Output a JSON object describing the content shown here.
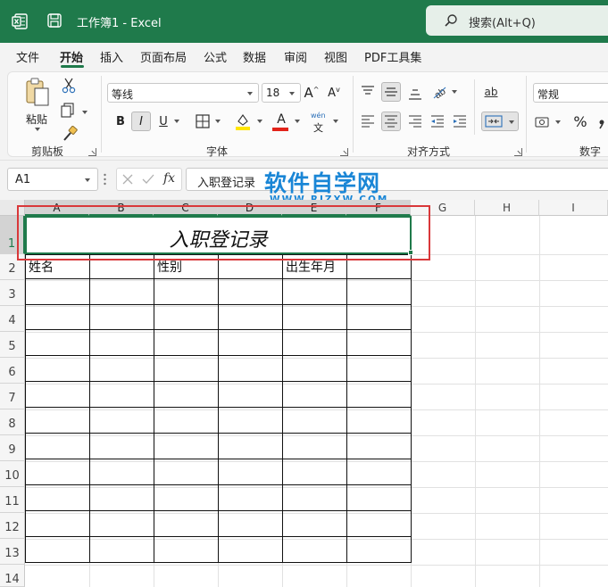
{
  "titlebar": {
    "doc_title": "工作簿1  -  Excel",
    "search_label": "搜索(Alt+Q)"
  },
  "tabs": [
    "文件",
    "开始",
    "插入",
    "页面布局",
    "公式",
    "数据",
    "审阅",
    "视图",
    "PDF工具集"
  ],
  "active_tab": "开始",
  "ribbon": {
    "clipboard": {
      "paste_label": "粘贴",
      "group_label": "剪贴板"
    },
    "font": {
      "font_name": "等线",
      "font_size": "18",
      "bold": "B",
      "italic": "I",
      "underline": "U",
      "grow": "A",
      "shrink": "A",
      "font_color": "A",
      "phonetic_top": "wén",
      "phonetic_bottom": "文",
      "group_label": "字体"
    },
    "alignment": {
      "group_label": "对齐方式",
      "wrap_label": "ab"
    },
    "number": {
      "format": "常规",
      "percent": "%",
      "group_label": "数字"
    }
  },
  "formula_bar": {
    "name_box": "A1",
    "fx_label": "fx",
    "content": "入职登记录"
  },
  "watermark": {
    "big": "软件自学网",
    "small": "WWW.RJZXW.COM"
  },
  "sheet": {
    "columns": [
      "A",
      "B",
      "C",
      "D",
      "E",
      "F",
      "G",
      "H",
      "I"
    ],
    "rows": [
      "1",
      "2",
      "3",
      "4",
      "5",
      "6",
      "7",
      "8",
      "9",
      "10",
      "11",
      "12",
      "13",
      "14"
    ],
    "title_cell": "入职登记录",
    "header_cells": [
      "姓名",
      "性别",
      "出生年月"
    ]
  },
  "colors": {
    "accent": "#1f7a4b",
    "highlight": "#d9383a",
    "watermark": "#1a86d6"
  }
}
